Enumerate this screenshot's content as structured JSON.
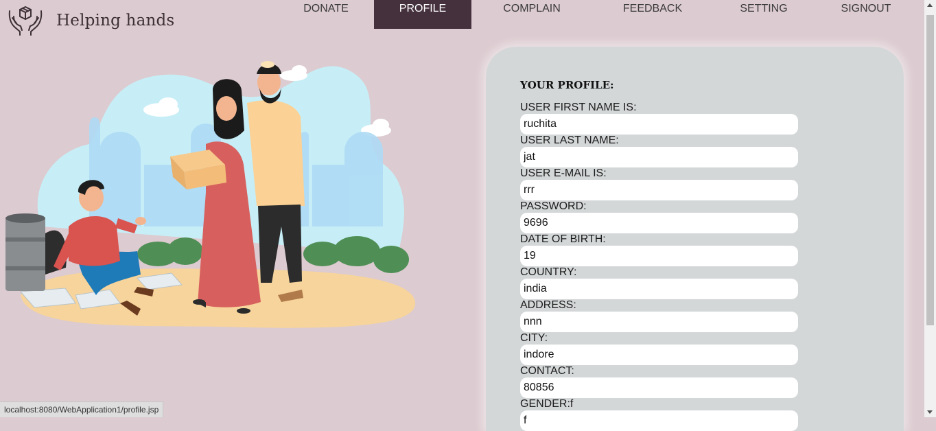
{
  "brand": {
    "name": "Helping hands",
    "logo_icon": "hands-gift-icon"
  },
  "nav": {
    "items": [
      {
        "label": "DONATE"
      },
      {
        "label": "PROFILE",
        "active": true
      },
      {
        "label": "COMPLAIN"
      },
      {
        "label": "FEEDBACK"
      },
      {
        "label": "SETTING"
      },
      {
        "label": "SIGNOUT"
      }
    ]
  },
  "illustration": {
    "icon": "charity-donation-illustration"
  },
  "profile": {
    "title": "YOUR PROFILE:",
    "fields": [
      {
        "label": "USER FIRST NAME IS:",
        "value": "ruchita"
      },
      {
        "label": "USER LAST NAME:",
        "value": "jat"
      },
      {
        "label": "USER E-MAIL IS:",
        "value": "rrr"
      },
      {
        "label": "PASSWORD:",
        "value": "9696"
      },
      {
        "label": "DATE OF BIRTH:",
        "value": "19"
      },
      {
        "label": "COUNTRY:",
        "value": "india"
      },
      {
        "label": "ADDRESS:",
        "value": "nnn"
      },
      {
        "label": "CITY:",
        "value": "indore"
      },
      {
        "label": "CONTACT:",
        "value": "80856"
      },
      {
        "label": "GENDER:f",
        "value": "f"
      }
    ]
  },
  "statusbar": {
    "url": "localhost:8080/WebApplication1/profile.jsp"
  },
  "colors": {
    "page_bg": "#dccbd0",
    "nav_active_bg": "#45313d",
    "panel_bg": "#d4d7d8",
    "input_bg": "#ffffff"
  }
}
